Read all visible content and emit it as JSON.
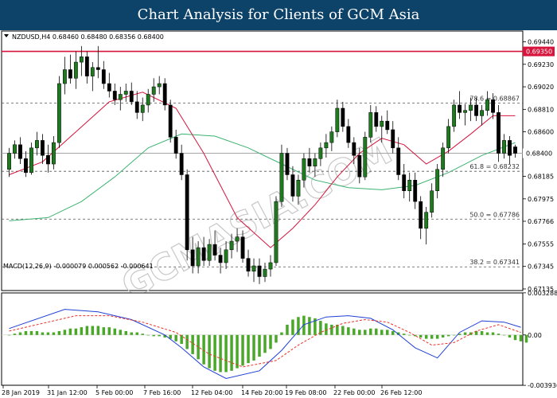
{
  "header": {
    "title": "Chart Analysis for Clients of GCM Asia"
  },
  "chart_data": [
    {
      "type": "candlestick",
      "symbol_info": "NZDUSD,H4  0.68460 0.68480 0.68356 0.68400",
      "ylim": [
        0.6712,
        0.6954
      ],
      "y_ticks": [
        "0.69440",
        "0.69230",
        "0.69020",
        "0.68810",
        "0.68600",
        "0.68400",
        "0.68185",
        "0.67975",
        "0.67766",
        "0.67555",
        "0.67345",
        "0.67135"
      ],
      "current_price": {
        "value": 0.684,
        "label": "0.68400"
      },
      "resistance": {
        "value": 0.6935,
        "label": "0.69350",
        "color": "#d6143c"
      },
      "fibonacci": [
        {
          "label": "78.6 = 0.68867",
          "value": 0.68867
        },
        {
          "label": "61.8 = 0.68232",
          "value": 0.68232
        },
        {
          "label": "50.0 = 0.67786",
          "value": 0.67786
        },
        {
          "label": "38.2 = 0.67341",
          "value": 0.67341
        }
      ],
      "x_labels": [
        "28 Jan 2019",
        "31 Jan 12:00",
        "5 Feb 00:00",
        "7 Feb 16:00",
        "12 Feb 04:00",
        "14 Feb 20:00",
        "19 Feb 08:00",
        "22 Feb 00:00",
        "26 Feb 12:00"
      ],
      "ohlc": [
        [
          0.6825,
          0.6845,
          0.6818,
          0.684
        ],
        [
          0.684,
          0.6852,
          0.6835,
          0.6848
        ],
        [
          0.6848,
          0.6855,
          0.683,
          0.6835
        ],
        [
          0.6835,
          0.6842,
          0.6818,
          0.6822
        ],
        [
          0.6822,
          0.685,
          0.682,
          0.6845
        ],
        [
          0.6845,
          0.686,
          0.6838,
          0.6852
        ],
        [
          0.6852,
          0.6858,
          0.683,
          0.6838
        ],
        [
          0.6838,
          0.6848,
          0.6822,
          0.683
        ],
        [
          0.683,
          0.6856,
          0.6825,
          0.685
        ],
        [
          0.685,
          0.6912,
          0.6845,
          0.6905
        ],
        [
          0.6905,
          0.693,
          0.6895,
          0.6918
        ],
        [
          0.6918,
          0.6932,
          0.6905,
          0.691
        ],
        [
          0.691,
          0.6935,
          0.69,
          0.6925
        ],
        [
          0.6925,
          0.694,
          0.6912,
          0.693
        ],
        [
          0.693,
          0.6935,
          0.6905,
          0.6912
        ],
        [
          0.6912,
          0.6925,
          0.6898,
          0.692
        ],
        [
          0.692,
          0.694,
          0.691,
          0.6918
        ],
        [
          0.6918,
          0.6926,
          0.69,
          0.6905
        ],
        [
          0.6905,
          0.6915,
          0.6892,
          0.6898
        ],
        [
          0.6898,
          0.6905,
          0.6885,
          0.689
        ],
        [
          0.689,
          0.6902,
          0.688,
          0.6895
        ],
        [
          0.6895,
          0.6905,
          0.6888,
          0.6898
        ],
        [
          0.6898,
          0.6906,
          0.6885,
          0.6888
        ],
        [
          0.6888,
          0.6898,
          0.6872,
          0.6878
        ],
        [
          0.6878,
          0.6892,
          0.687,
          0.6885
        ],
        [
          0.6885,
          0.69,
          0.6878,
          0.6895
        ],
        [
          0.6895,
          0.691,
          0.6888,
          0.6902
        ],
        [
          0.6902,
          0.6912,
          0.6895,
          0.6905
        ],
        [
          0.6905,
          0.691,
          0.688,
          0.6885
        ],
        [
          0.6885,
          0.689,
          0.685,
          0.6855
        ],
        [
          0.6855,
          0.6862,
          0.6835,
          0.684
        ],
        [
          0.684,
          0.6848,
          0.6815,
          0.682
        ],
        [
          0.682,
          0.6825,
          0.674,
          0.675
        ],
        [
          0.675,
          0.6762,
          0.6728,
          0.6735
        ],
        [
          0.6735,
          0.6758,
          0.6728,
          0.6752
        ],
        [
          0.6752,
          0.6762,
          0.6735,
          0.674
        ],
        [
          0.674,
          0.676,
          0.6735,
          0.6755
        ],
        [
          0.6755,
          0.6768,
          0.674,
          0.6745
        ],
        [
          0.6745,
          0.6752,
          0.6728,
          0.6738
        ],
        [
          0.6738,
          0.6758,
          0.6732,
          0.675
        ],
        [
          0.675,
          0.6765,
          0.6742,
          0.6758
        ],
        [
          0.6758,
          0.677,
          0.6748,
          0.6762
        ],
        [
          0.6762,
          0.6768,
          0.6738,
          0.6742
        ],
        [
          0.6742,
          0.675,
          0.6725,
          0.673
        ],
        [
          0.673,
          0.6742,
          0.672,
          0.6735
        ],
        [
          0.6735,
          0.6742,
          0.6718,
          0.6725
        ],
        [
          0.6725,
          0.6738,
          0.672,
          0.6732
        ],
        [
          0.6732,
          0.6745,
          0.6725,
          0.6738
        ],
        [
          0.6738,
          0.68,
          0.6735,
          0.6795
        ],
        [
          0.6795,
          0.6848,
          0.679,
          0.684
        ],
        [
          0.684,
          0.6845,
          0.6815,
          0.682
        ],
        [
          0.682,
          0.6828,
          0.6795,
          0.68
        ],
        [
          0.68,
          0.682,
          0.6792,
          0.6815
        ],
        [
          0.6815,
          0.684,
          0.6808,
          0.6835
        ],
        [
          0.6835,
          0.6845,
          0.6822,
          0.6828
        ],
        [
          0.6828,
          0.684,
          0.6818,
          0.6835
        ],
        [
          0.6835,
          0.685,
          0.6828,
          0.6845
        ],
        [
          0.6845,
          0.6858,
          0.6836,
          0.685
        ],
        [
          0.685,
          0.6865,
          0.6842,
          0.686
        ],
        [
          0.686,
          0.689,
          0.6855,
          0.6882
        ],
        [
          0.6882,
          0.6888,
          0.686,
          0.6865
        ],
        [
          0.6865,
          0.6872,
          0.6845,
          0.685
        ],
        [
          0.685,
          0.6855,
          0.683,
          0.6838
        ],
        [
          0.6838,
          0.6845,
          0.6812,
          0.6818
        ],
        [
          0.6818,
          0.686,
          0.6815,
          0.6855
        ],
        [
          0.6855,
          0.6885,
          0.685,
          0.6878
        ],
        [
          0.6878,
          0.6884,
          0.686,
          0.6865
        ],
        [
          0.6865,
          0.6875,
          0.685,
          0.687
        ],
        [
          0.687,
          0.688,
          0.6858,
          0.6862
        ],
        [
          0.6862,
          0.687,
          0.684,
          0.6845
        ],
        [
          0.6845,
          0.6855,
          0.6815,
          0.682
        ],
        [
          0.682,
          0.683,
          0.6798,
          0.6805
        ],
        [
          0.6805,
          0.6822,
          0.6795,
          0.6815
        ],
        [
          0.6815,
          0.6822,
          0.6788,
          0.6795
        ],
        [
          0.6795,
          0.68,
          0.676,
          0.677
        ],
        [
          0.677,
          0.679,
          0.6755,
          0.6785
        ],
        [
          0.6785,
          0.6812,
          0.678,
          0.6805
        ],
        [
          0.6805,
          0.683,
          0.6798,
          0.6825
        ],
        [
          0.6825,
          0.685,
          0.6818,
          0.6845
        ],
        [
          0.6845,
          0.6872,
          0.684,
          0.6865
        ],
        [
          0.6865,
          0.689,
          0.686,
          0.6885
        ],
        [
          0.6885,
          0.6898,
          0.6872,
          0.6878
        ],
        [
          0.6878,
          0.6886,
          0.6866,
          0.688
        ],
        [
          0.688,
          0.6892,
          0.687,
          0.6885
        ],
        [
          0.6885,
          0.6892,
          0.687,
          0.6875
        ],
        [
          0.6875,
          0.6885,
          0.6866,
          0.688
        ],
        [
          0.688,
          0.6898,
          0.6875,
          0.689
        ],
        [
          0.689,
          0.6896,
          0.6872,
          0.6878
        ],
        [
          0.6878,
          0.6885,
          0.6832,
          0.684
        ],
        [
          0.684,
          0.6858,
          0.6835,
          0.6852
        ],
        [
          0.6852,
          0.6856,
          0.683,
          0.6838
        ],
        [
          0.6846,
          0.6848,
          0.6836,
          0.684
        ]
      ],
      "overlays": {
        "ma_red_color": "#d6143c",
        "ma_green_color": "#3cb371",
        "ma_red": [
          [
            0,
            0.682
          ],
          [
            6,
            0.6832
          ],
          [
            12,
            0.686
          ],
          [
            18,
            0.6888
          ],
          [
            24,
            0.6897
          ],
          [
            30,
            0.6882
          ],
          [
            35,
            0.684
          ],
          [
            41,
            0.678
          ],
          [
            47,
            0.6752
          ],
          [
            51,
            0.677
          ],
          [
            55,
            0.6792
          ],
          [
            59,
            0.6818
          ],
          [
            63,
            0.684
          ],
          [
            67,
            0.6854
          ],
          [
            71,
            0.6848
          ],
          [
            75,
            0.683
          ],
          [
            79,
            0.6842
          ],
          [
            83,
            0.6858
          ],
          [
            87,
            0.6875
          ],
          [
            91,
            0.6875
          ]
        ],
        "ma_green": [
          [
            0,
            0.6777
          ],
          [
            7,
            0.678
          ],
          [
            13,
            0.6795
          ],
          [
            19,
            0.6818
          ],
          [
            25,
            0.6845
          ],
          [
            31,
            0.6858
          ],
          [
            37,
            0.6856
          ],
          [
            43,
            0.6845
          ],
          [
            49,
            0.683
          ],
          [
            55,
            0.6815
          ],
          [
            61,
            0.6808
          ],
          [
            67,
            0.6806
          ],
          [
            73,
            0.681
          ],
          [
            79,
            0.6822
          ],
          [
            85,
            0.6838
          ],
          [
            91,
            0.685
          ]
        ]
      },
      "candle_colors": {
        "up": "#1f7a1f",
        "down": "#000000"
      },
      "watermark": "GCMASIA.COM"
    },
    {
      "type": "bar",
      "indicator": "MACD",
      "label": "MACD(12,26,9) -0.000079 0.000562 -0.000641",
      "ylim": [
        -0.00393,
        0.00328
      ],
      "y_ticks": [
        "0.003288",
        "0.00",
        "-0.003936"
      ],
      "histogram_color": "#4aa829",
      "macd_line_color": "#1f3fd6",
      "signal_line_color": "#e8322a",
      "histogram": [
        0.0,
        0.0001,
        0.0002,
        0.0003,
        0.0003,
        0.0003,
        0.0002,
        0.0002,
        0.0002,
        0.0003,
        0.0004,
        0.0005,
        0.0005,
        0.0006,
        0.0007,
        0.0007,
        0.0007,
        0.0006,
        0.0006,
        0.0005,
        0.0004,
        0.0003,
        0.0002,
        0.0002,
        0.0001,
        0.0,
        -0.0001,
        -0.0001,
        -0.0002,
        -0.0003,
        -0.0005,
        -0.0007,
        -0.0011,
        -0.0015,
        -0.0019,
        -0.0023,
        -0.0026,
        -0.0028,
        -0.0029,
        -0.0029,
        -0.0028,
        -0.0026,
        -0.0024,
        -0.0022,
        -0.002,
        -0.0017,
        -0.0014,
        -0.0011,
        -0.0006,
        0.0002,
        0.0008,
        0.0012,
        0.0014,
        0.0015,
        0.0014,
        0.0013,
        0.0011,
        0.0009,
        0.0008,
        0.0008,
        0.0007,
        0.0006,
        0.0005,
        0.0004,
        0.0004,
        0.0005,
        0.0005,
        0.0004,
        0.0004,
        0.0003,
        0.0002,
        0.0001,
        0.0,
        -0.0001,
        -0.0002,
        -0.0003,
        -0.0003,
        -0.0003,
        -0.0002,
        -0.0001,
        0.0,
        0.0001,
        0.0002,
        0.0002,
        0.0003,
        0.0003,
        0.0002,
        0.0002,
        0.0001,
        0.0,
        -0.0002,
        -0.0004,
        -0.0005,
        -0.0006
      ],
      "macd": [
        [
          0,
          0.0005
        ],
        [
          10,
          0.002
        ],
        [
          16,
          0.0018
        ],
        [
          22,
          0.0012
        ],
        [
          28,
          0.0
        ],
        [
          31,
          -0.001
        ],
        [
          35,
          -0.0025
        ],
        [
          39,
          -0.0034
        ],
        [
          45,
          -0.0028
        ],
        [
          49,
          -0.0012
        ],
        [
          53,
          0.0008
        ],
        [
          57,
          0.0014
        ],
        [
          61,
          0.0015
        ],
        [
          65,
          0.0013
        ],
        [
          69,
          0.0004
        ],
        [
          73,
          -0.001
        ],
        [
          77,
          -0.0018
        ],
        [
          81,
          0.0002
        ],
        [
          85,
          0.0011
        ],
        [
          89,
          0.001
        ],
        [
          92,
          0.0006
        ]
      ],
      "signal": [
        [
          0,
          0.0003
        ],
        [
          12,
          0.0015
        ],
        [
          18,
          0.0015
        ],
        [
          24,
          0.001
        ],
        [
          30,
          0.0002
        ],
        [
          36,
          -0.0015
        ],
        [
          42,
          -0.0025
        ],
        [
          48,
          -0.002
        ],
        [
          52,
          -0.0008
        ],
        [
          56,
          0.0002
        ],
        [
          60,
          0.0009
        ],
        [
          64,
          0.0012
        ],
        [
          68,
          0.001
        ],
        [
          72,
          0.0002
        ],
        [
          76,
          -0.0008
        ],
        [
          80,
          -0.0006
        ],
        [
          84,
          0.0003
        ],
        [
          88,
          0.0008
        ],
        [
          92,
          0.0002
        ]
      ]
    }
  ]
}
